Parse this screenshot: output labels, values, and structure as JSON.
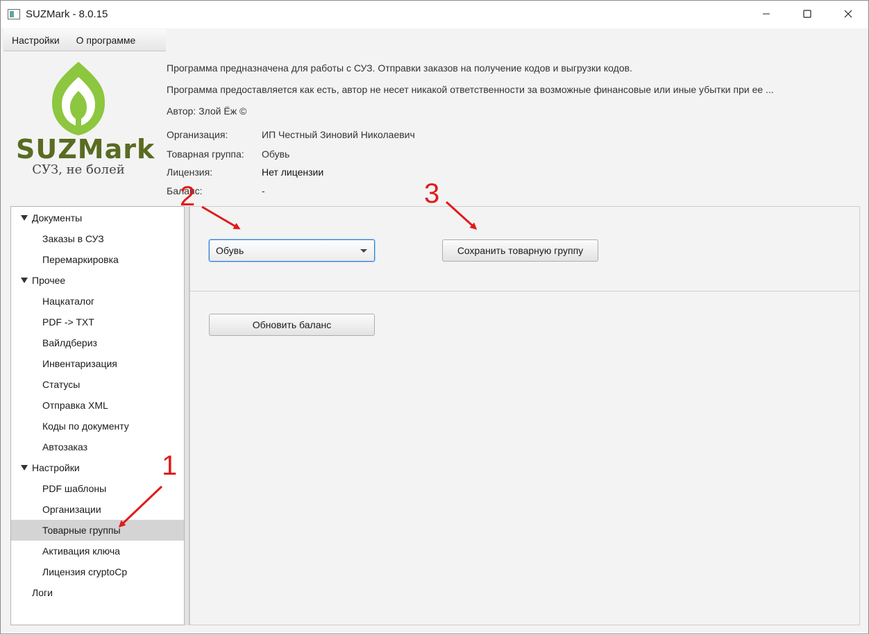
{
  "window": {
    "title": "SUZMark - 8.0.15"
  },
  "menu": {
    "items": [
      "Настройки",
      "О программе"
    ]
  },
  "logo": {
    "name": "SUZMark",
    "tagline": "СУЗ, не болей",
    "color": "#8dc63f"
  },
  "info": {
    "line1": "Программа предназначена для работы с СУЗ. Отправки заказов на получение кодов и выгрузки кодов.",
    "line2": "Программа предоставляется как есть, автор не несет никакой ответственности за возможные финансовые или иные убытки при ее ...",
    "author": "Автор: Злой Ёж ©",
    "fields": [
      {
        "key": "Организация:",
        "value": "ИП Честный Зиновий Николаевич"
      },
      {
        "key": "Товарная группа:",
        "value": "Обувь"
      },
      {
        "key": "Лицензия:",
        "value": "Нет лицензии"
      },
      {
        "key": "Баланс:",
        "value": "-"
      }
    ]
  },
  "tree": [
    {
      "label": "Документы",
      "level": 0,
      "expanded": true
    },
    {
      "label": "Заказы в СУЗ",
      "level": 1
    },
    {
      "label": "Перемаркировка",
      "level": 1
    },
    {
      "label": "Прочее",
      "level": 0,
      "expanded": true
    },
    {
      "label": "Нацкаталог",
      "level": 1
    },
    {
      "label": "PDF -> TXT",
      "level": 1
    },
    {
      "label": "Вайлдбериз",
      "level": 1
    },
    {
      "label": "Инвентаризация",
      "level": 1
    },
    {
      "label": "Статусы",
      "level": 1
    },
    {
      "label": "Отправка XML",
      "level": 1
    },
    {
      "label": "Коды по документу",
      "level": 1
    },
    {
      "label": "Автозаказ",
      "level": 1
    },
    {
      "label": "Настройки",
      "level": 0,
      "expanded": true
    },
    {
      "label": "PDF шаблоны",
      "level": 1
    },
    {
      "label": "Организации",
      "level": 1
    },
    {
      "label": "Товарные группы",
      "level": 1,
      "selected": true
    },
    {
      "label": "Активация ключа",
      "level": 1
    },
    {
      "label": "Лицензия cryptoCp",
      "level": 1
    },
    {
      "label": "Логи",
      "level": 0
    }
  ],
  "panel": {
    "combo_value": "Обувь",
    "save_button": "Сохранить товарную группу",
    "refresh_button": "Обновить баланс"
  },
  "annotations": {
    "labels": [
      "1",
      "2",
      "3"
    ],
    "color": "#e11b1b"
  }
}
